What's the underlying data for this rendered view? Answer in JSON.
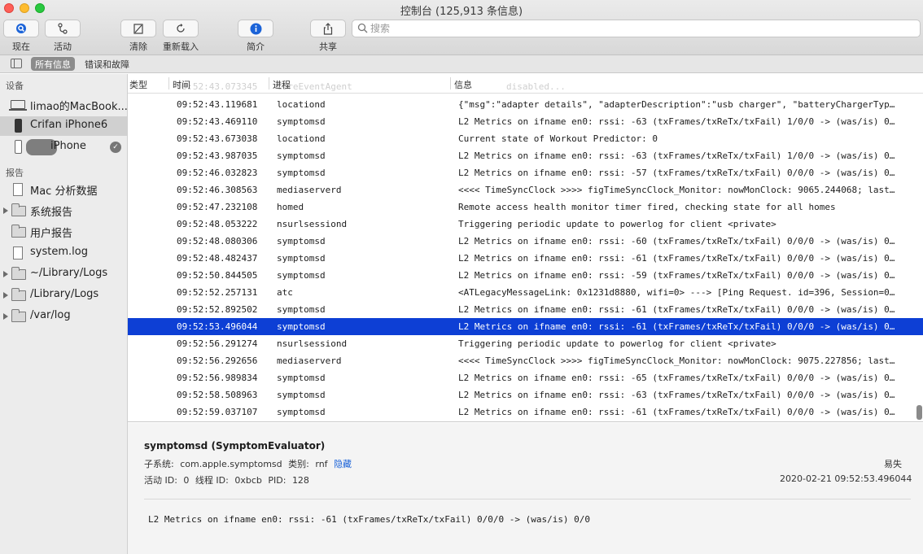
{
  "window": {
    "title": "控制台 (125,913 条信息)"
  },
  "toolbar": {
    "now_label": "现在",
    "activity_label": "活动",
    "clear_label": "清除",
    "reload_label": "重新载入",
    "info_label": "简介",
    "share_label": "共享",
    "search_placeholder": "搜索"
  },
  "scope": {
    "tab_all": "所有信息",
    "tab_errors": "错误和故障"
  },
  "sidebar": {
    "devices_header": "设备",
    "devices": [
      {
        "label": "limao的MacBook...",
        "icon": "laptop-icon"
      },
      {
        "label": "Crifan iPhone6",
        "icon": "iphone-icon",
        "selected": true
      },
      {
        "label": "iPhone",
        "icon": "iphone-icon",
        "badge": "✓"
      }
    ],
    "reports_header": "报告",
    "reports": [
      {
        "label": "Mac 分析数据",
        "icon": "document-icon"
      },
      {
        "label": "系统报告",
        "icon": "folder-icon"
      },
      {
        "label": "用户报告",
        "icon": "folder-icon"
      },
      {
        "label": "system.log",
        "icon": "document-icon"
      },
      {
        "label": "~/Library/Logs",
        "icon": "folder-icon"
      },
      {
        "label": "/Library/Logs",
        "icon": "folder-icon"
      },
      {
        "label": "/var/log",
        "icon": "folder-icon"
      }
    ]
  },
  "table": {
    "col_type": "类型",
    "col_time": "时间",
    "col_process": "进程",
    "col_message": "信息",
    "ghost_time": "09:52:43.073345",
    "ghost_process": "CoreEventAgent",
    "ghost_message": "disabled...",
    "rows": [
      {
        "time": "09:52:43.119681",
        "process": "locationd",
        "message": "{\"msg\":\"adapter details\", \"adapterDescription\":\"usb charger\", \"batteryChargerTyp…"
      },
      {
        "time": "09:52:43.469110",
        "process": "symptomsd",
        "message": "L2 Metrics on ifname en0: rssi: -63 (txFrames/txReTx/txFail) 1/0/0 -> (was/is) 0…"
      },
      {
        "time": "09:52:43.673038",
        "process": "locationd",
        "message": "Current state of Workout Predictor: 0"
      },
      {
        "time": "09:52:43.987035",
        "process": "symptomsd",
        "message": "L2 Metrics on ifname en0: rssi: -63 (txFrames/txReTx/txFail) 1/0/0 -> (was/is) 0…"
      },
      {
        "time": "09:52:46.032823",
        "process": "symptomsd",
        "message": "L2 Metrics on ifname en0: rssi: -57 (txFrames/txReTx/txFail) 0/0/0 -> (was/is) 0…"
      },
      {
        "time": "09:52:46.308563",
        "process": "mediaserverd",
        "message": "<<<< TimeSyncClock >>>> figTimeSyncClock_Monitor: nowMonClock: 9065.244068; last…"
      },
      {
        "time": "09:52:47.232108",
        "process": "homed",
        "message": "Remote access health monitor timer fired, checking state for all homes"
      },
      {
        "time": "09:52:48.053222",
        "process": "nsurlsessiond",
        "message": "Triggering periodic update to powerlog for client <private>"
      },
      {
        "time": "09:52:48.080306",
        "process": "symptomsd",
        "message": "L2 Metrics on ifname en0: rssi: -60 (txFrames/txReTx/txFail) 0/0/0 -> (was/is) 0…"
      },
      {
        "time": "09:52:48.482437",
        "process": "symptomsd",
        "message": "L2 Metrics on ifname en0: rssi: -61 (txFrames/txReTx/txFail) 0/0/0 -> (was/is) 0…"
      },
      {
        "time": "09:52:50.844505",
        "process": "symptomsd",
        "message": "L2 Metrics on ifname en0: rssi: -59 (txFrames/txReTx/txFail) 0/0/0 -> (was/is) 0…"
      },
      {
        "time": "09:52:52.257131",
        "process": "atc",
        "message": "<ATLegacyMessageLink: 0x1231d8880, wifi=0> ---> [Ping Request. id=396, Session=0…"
      },
      {
        "time": "09:52:52.892502",
        "process": "symptomsd",
        "message": "L2 Metrics on ifname en0: rssi: -61 (txFrames/txReTx/txFail) 0/0/0 -> (was/is) 0…"
      },
      {
        "time": "09:52:53.496044",
        "process": "symptomsd",
        "message": "L2 Metrics on ifname en0: rssi: -61 (txFrames/txReTx/txFail) 0/0/0 -> (was/is) 0…",
        "selected": true
      },
      {
        "time": "09:52:56.291274",
        "process": "nsurlsessiond",
        "message": "Triggering periodic update to powerlog for client <private>"
      },
      {
        "time": "09:52:56.292656",
        "process": "mediaserverd",
        "message": "<<<< TimeSyncClock >>>> figTimeSyncClock_Monitor: nowMonClock: 9075.227856; last…"
      },
      {
        "time": "09:52:56.989834",
        "process": "symptomsd",
        "message": "L2 Metrics on ifname en0: rssi: -65 (txFrames/txReTx/txFail) 0/0/0 -> (was/is) 0…"
      },
      {
        "time": "09:52:58.508963",
        "process": "symptomsd",
        "message": "L2 Metrics on ifname en0: rssi: -63 (txFrames/txReTx/txFail) 0/0/0 -> (was/is) 0…"
      },
      {
        "time": "09:52:59.037107",
        "process": "symptomsd",
        "message": "L2 Metrics on ifname en0: rssi: -61 (txFrames/txReTx/txFail) 0/0/0 -> (was/is) 0…"
      }
    ]
  },
  "detail": {
    "title": "symptomsd (SymptomEvaluator)",
    "subsystem_label": "子系统:",
    "subsystem_value": "com.apple.symptomsd",
    "category_label": "类别:",
    "category_value": "rnf",
    "hide_link": "隐藏",
    "volatile_label": "易失",
    "activity_label": "活动 ID:",
    "activity_value": "0",
    "thread_label": "线程 ID:",
    "thread_value": "0xbcb",
    "pid_label": "PID:",
    "pid_value": "128",
    "timestamp": "2020-02-21 09:52:53.496044",
    "message": "L2 Metrics on ifname en0: rssi: -61 (txFrames/txReTx/txFail) 0/0/0 -> (was/is) 0/0"
  },
  "colors": {
    "selection": "#0d3fd5",
    "link": "#1b63d8",
    "info_icon": "#1b63d8"
  }
}
